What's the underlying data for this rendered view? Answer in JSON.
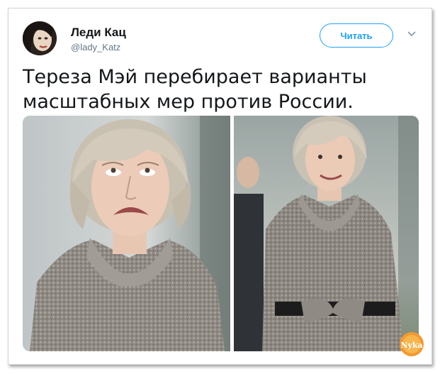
{
  "tweet": {
    "display_name": "Леди Кац",
    "handle": "@lady_Katz",
    "follow_label": "Читать",
    "text": "Тереза Мэй перебирает варианты масштабных мер против России.",
    "watermark": "Nyka"
  },
  "icons": {
    "caret": "chevron-down-icon",
    "avatar": "avatar"
  },
  "colors": {
    "accent": "#1da1f2",
    "text": "#14171a",
    "muted": "#657786"
  }
}
